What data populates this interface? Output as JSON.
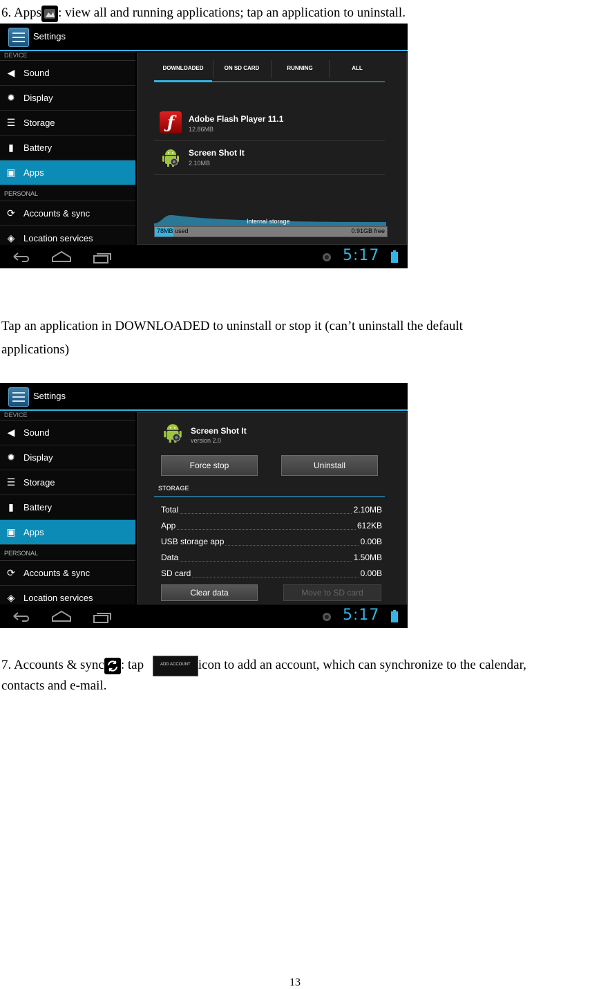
{
  "section6": {
    "pre": "6. Apps",
    "post": ": view all and running applications; tap an application to uninstall."
  },
  "screenshot1": {
    "title": "Settings",
    "sidebar": {
      "device_header": "DEVICE",
      "items": [
        "Sound",
        "Display",
        "Storage",
        "Battery",
        "Apps"
      ],
      "personal_header": "PERSONAL",
      "items2": [
        "Accounts & sync",
        "Location services"
      ]
    },
    "tabs": [
      "DOWNLOADED",
      "ON SD CARD",
      "RUNNING",
      "ALL"
    ],
    "apps": [
      {
        "name": "Adobe Flash Player 11.1",
        "size": "12.86MB"
      },
      {
        "name": "Screen Shot It",
        "size": "2.10MB"
      }
    ],
    "storage_label": "Internal storage",
    "used": "78MB used",
    "free": "0.91GB free",
    "used_fraction": 0.08,
    "clock": "5:17"
  },
  "caption_mid": {
    "line1": "Tap an application in DOWNLOADED to uninstall or stop it (can’t uninstall the default",
    "line2": "applications)"
  },
  "screenshot2": {
    "title": "Settings",
    "sidebar": {
      "device_header": "DEVICE",
      "items": [
        "Sound",
        "Display",
        "Storage",
        "Battery",
        "Apps"
      ],
      "personal_header": "PERSONAL",
      "items2": [
        "Accounts & sync",
        "Location services"
      ]
    },
    "app_name": "Screen Shot It",
    "app_version": "version 2.0",
    "force_stop": "Force stop",
    "uninstall": "Uninstall",
    "storage_header": "STORAGE",
    "rows": [
      {
        "k": "Total",
        "v": "2.10MB"
      },
      {
        "k": "App",
        "v": "612KB"
      },
      {
        "k": "USB storage app",
        "v": "0.00B"
      },
      {
        "k": "Data",
        "v": "1.50MB"
      },
      {
        "k": "SD card",
        "v": "0.00B"
      }
    ],
    "clear_data": "Clear data",
    "move_sd": "Move to SD card",
    "clock": "5:17"
  },
  "section7": {
    "pre": "7. Accounts & sync",
    "mid": ": tap",
    "button_text": "ADD ACCOUNT",
    "post": "icon to add an account, which can synchronize to the calendar,",
    "line2": "contacts and e-mail."
  },
  "page_number": "13",
  "colors": {
    "accent": "#33b5e5",
    "active_item": "#0d8bb7",
    "panel": "#1e1e1e"
  }
}
